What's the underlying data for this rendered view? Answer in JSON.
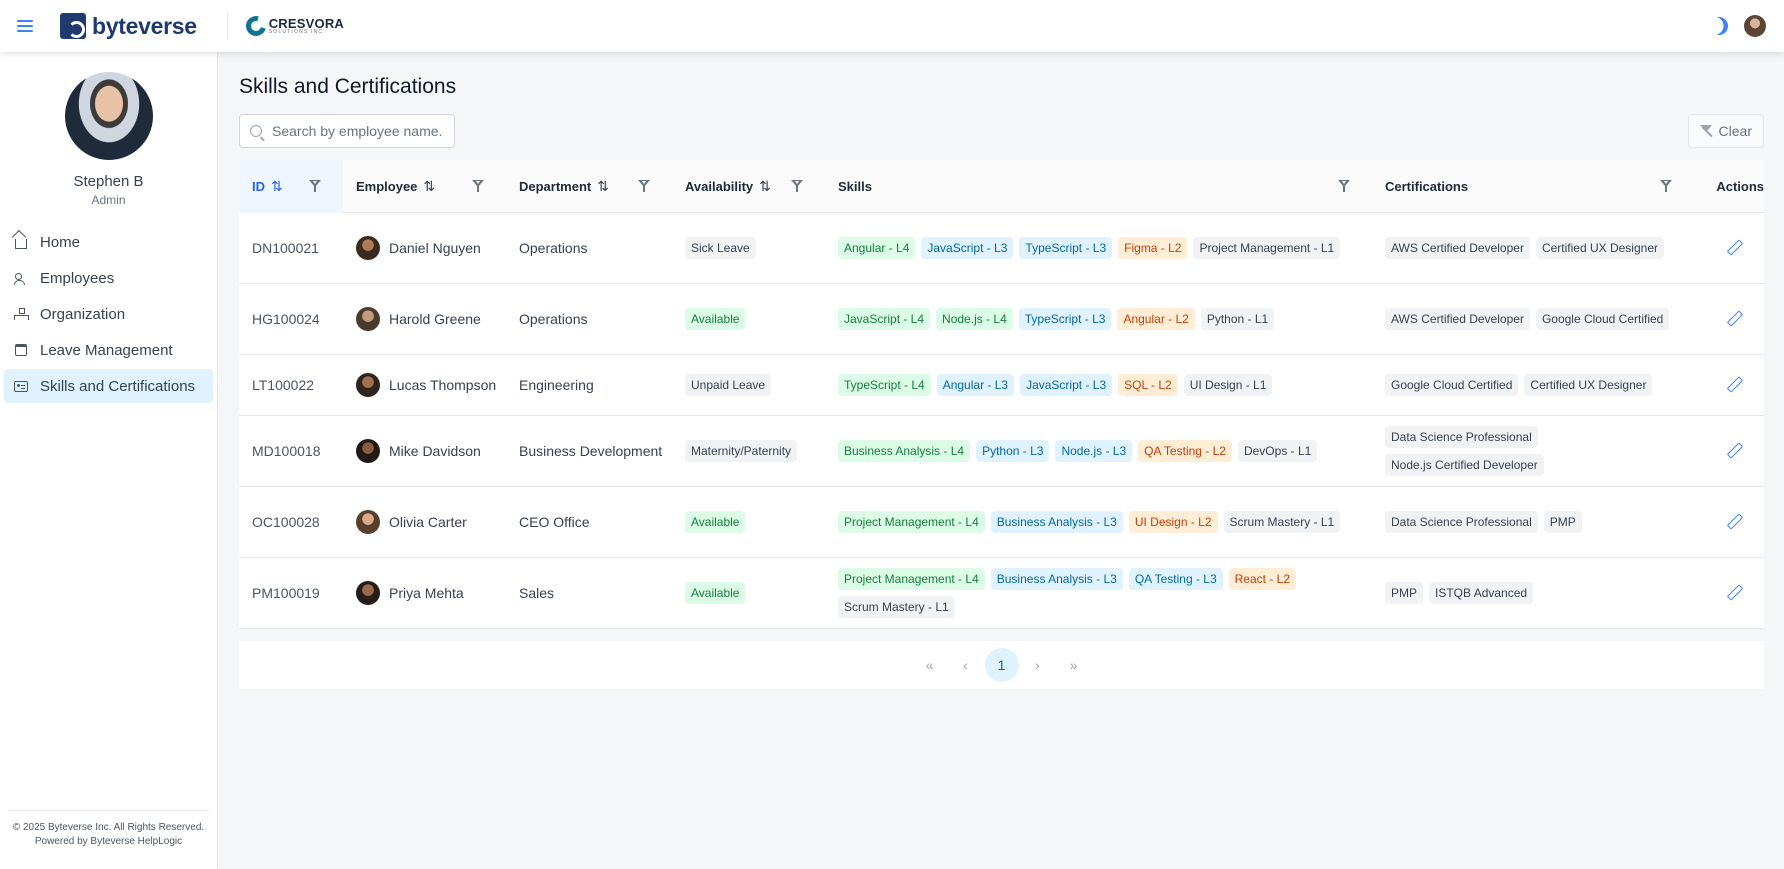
{
  "header": {
    "brand": "byteverse",
    "client_name": "CRESVORA",
    "client_sub": "SOLUTIONS INC."
  },
  "sidebar": {
    "user_name": "Stephen B",
    "user_role": "Admin",
    "items": [
      {
        "label": "Home",
        "icon": "home-icon"
      },
      {
        "label": "Employees",
        "icon": "users-icon"
      },
      {
        "label": "Organization",
        "icon": "org-chart-icon"
      },
      {
        "label": "Leave Management",
        "icon": "calendar-icon"
      },
      {
        "label": "Skills and Certifications",
        "icon": "id-card-icon",
        "active": true
      }
    ],
    "footer_line1": "© 2025 Byteverse Inc. All Rights Reserved.",
    "footer_line2": "Powered by Byteverse HelpLogic"
  },
  "main": {
    "title": "Skills and Certifications",
    "search_placeholder": "Search by employee name...",
    "clear_label": "Clear",
    "columns": {
      "id": "ID",
      "employee": "Employee",
      "department": "Department",
      "availability": "Availability",
      "skills": "Skills",
      "certifications": "Certifications",
      "actions": "Actions"
    },
    "rows": [
      {
        "id": "DN100021",
        "name": "Daniel Nguyen",
        "dept": "Operations",
        "availability": "Sick Leave",
        "availability_style": "gray",
        "skills": [
          [
            "Angular - L4",
            "green"
          ],
          [
            "JavaScript - L3",
            "blue"
          ],
          [
            "TypeScript - L3",
            "blue"
          ],
          [
            "Figma - L2",
            "orange"
          ],
          [
            "Project Management - L1",
            "gray"
          ]
        ],
        "certs": [
          "AWS Certified Developer",
          "Certified UX Designer"
        ]
      },
      {
        "id": "HG100024",
        "name": "Harold Greene",
        "dept": "Operations",
        "availability": "Available",
        "availability_style": "green",
        "skills": [
          [
            "JavaScript - L4",
            "green"
          ],
          [
            "Node.js - L4",
            "green"
          ],
          [
            "TypeScript - L3",
            "blue"
          ],
          [
            "Angular - L2",
            "orange"
          ],
          [
            "Python - L1",
            "gray"
          ]
        ],
        "certs": [
          "AWS Certified Developer",
          "Google Cloud Certified"
        ]
      },
      {
        "id": "LT100022",
        "name": "Lucas Thompson",
        "dept": "Engineering",
        "availability": "Unpaid Leave",
        "availability_style": "gray",
        "skills": [
          [
            "TypeScript - L4",
            "green"
          ],
          [
            "Angular - L3",
            "blue"
          ],
          [
            "JavaScript - L3",
            "blue"
          ],
          [
            "SQL - L2",
            "orange"
          ],
          [
            "UI Design - L1",
            "gray"
          ]
        ],
        "certs": [
          "Google Cloud Certified",
          "Certified UX Designer"
        ]
      },
      {
        "id": "MD100018",
        "name": "Mike Davidson",
        "dept": "Business Development",
        "availability": "Maternity/Paternity",
        "availability_style": "gray",
        "skills": [
          [
            "Business Analysis - L4",
            "green"
          ],
          [
            "Python - L3",
            "blue"
          ],
          [
            "Node.js - L3",
            "blue"
          ],
          [
            "QA Testing - L2",
            "orange"
          ],
          [
            "DevOps - L1",
            "gray"
          ]
        ],
        "certs": [
          "Data Science Professional",
          "Node.js Certified Developer"
        ]
      },
      {
        "id": "OC100028",
        "name": "Olivia Carter",
        "dept": "CEO Office",
        "availability": "Available",
        "availability_style": "green",
        "skills": [
          [
            "Project Management - L4",
            "green"
          ],
          [
            "Business Analysis - L3",
            "blue"
          ],
          [
            "UI Design - L2",
            "orange"
          ],
          [
            "Scrum Mastery - L1",
            "gray"
          ]
        ],
        "certs": [
          "Data Science Professional",
          "PMP"
        ]
      },
      {
        "id": "PM100019",
        "name": "Priya Mehta",
        "dept": "Sales",
        "availability": "Available",
        "availability_style": "green",
        "skills": [
          [
            "Project Management - L4",
            "green"
          ],
          [
            "Business Analysis - L3",
            "blue"
          ],
          [
            "QA Testing - L3",
            "blue"
          ],
          [
            "React - L2",
            "orange"
          ],
          [
            "Scrum Mastery - L1",
            "gray"
          ]
        ],
        "certs": [
          "PMP",
          "ISTQB Advanced"
        ]
      }
    ],
    "pagination": {
      "first": "«",
      "prev": "‹",
      "current": "1",
      "next": "›",
      "last": "»"
    }
  },
  "colors": {
    "accent": "#2563eb",
    "brand": "#1e3a6e",
    "active_nav": "#e0f2fe"
  }
}
